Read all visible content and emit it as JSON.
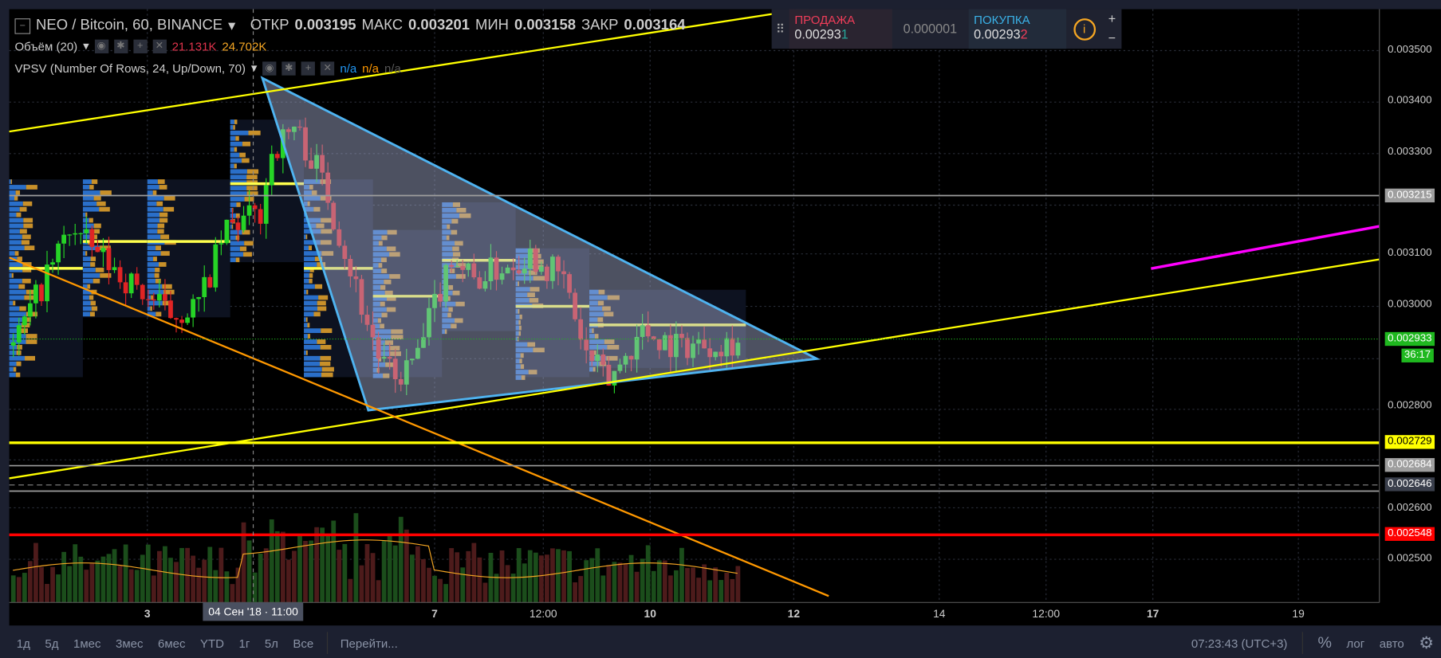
{
  "header": {
    "symbol": "NEO / Bitcoin, 60, BINANCE",
    "open_label": "ОТКР",
    "open": "0.003195",
    "high_label": "МАКС",
    "high": "0.003201",
    "low_label": "МИН",
    "low": "0.003158",
    "close_label": "ЗАКР",
    "close": "0.003164"
  },
  "volume_legend": {
    "name": "Объём (20)",
    "v1": "21.131K",
    "v2": "24.702K"
  },
  "vpsv_legend": {
    "name": "VPSV (Number Of Rows, 24, Up/Down, 70)",
    "v1": "n/a",
    "v2": "n/a",
    "v3": "n/a"
  },
  "trade": {
    "sell_label": "ПРОДАЖА",
    "sell_main": "0.00293",
    "sell_last": "1",
    "spread": "0.000001",
    "buy_label": "ПОКУПКА",
    "buy_main": "0.00293",
    "buy_last": "2",
    "plus": "+",
    "minus": "−"
  },
  "price_axis": [
    {
      "t": "0.003500",
      "p": 0.0035
    },
    {
      "t": "0.003400",
      "p": 0.0034
    },
    {
      "t": "0.003300",
      "p": 0.0033
    },
    {
      "t": "0.003100",
      "p": 0.0031
    },
    {
      "t": "0.003000",
      "p": 0.003
    },
    {
      "t": "0.002800",
      "p": 0.0028
    },
    {
      "t": "0.002600",
      "p": 0.0026
    },
    {
      "t": "0.002500",
      "p": 0.0025
    }
  ],
  "price_tags": [
    {
      "t": "0.003215",
      "p": 0.003215,
      "bg": "#9e9e9e",
      "fg": "#fff"
    },
    {
      "t": "0.002933",
      "p": 0.002933,
      "bg": "#1fb81f",
      "fg": "#fff"
    },
    {
      "t": "36:17",
      "p": 0.0029,
      "bg": "#1fb81f",
      "fg": "#fff"
    },
    {
      "t": "0.002729",
      "p": 0.002729,
      "bg": "#ffff00",
      "fg": "#000"
    },
    {
      "t": "0.002684",
      "p": 0.002684,
      "bg": "#9e9e9e",
      "fg": "#fff"
    },
    {
      "t": "0.002646",
      "p": 0.002646,
      "bg": "#3a3f4c",
      "fg": "#fff"
    },
    {
      "t": "0.002548",
      "p": 0.002548,
      "bg": "#ff0000",
      "fg": "#fff"
    }
  ],
  "time_axis": [
    "3",
    "7",
    "12:00",
    "10",
    "12",
    "14",
    "12:00",
    "17",
    "19"
  ],
  "crosshair_time": "04 Сен '18 · 11:00",
  "toolbar": {
    "ranges": [
      "1д",
      "5д",
      "1мес",
      "3мес",
      "6мес",
      "YTD",
      "1г",
      "5л",
      "Все"
    ],
    "goto": "Перейти...",
    "clock": "07:23:43 (UTC+3)",
    "percent": "%",
    "log": "лог",
    "auto": "авто"
  },
  "chart_data": {
    "type": "candlestick",
    "bars": 130,
    "price_path": [
      [
        0,
        0.00292
      ],
      [
        10,
        0.00315
      ],
      [
        20,
        0.00305
      ],
      [
        28,
        0.00298
      ],
      [
        33,
        0.003
      ],
      [
        38,
        0.00315
      ],
      [
        44,
        0.00318
      ],
      [
        46,
        0.0033
      ],
      [
        50,
        0.00335
      ],
      [
        55,
        0.00325
      ],
      [
        62,
        0.003
      ],
      [
        65,
        0.0029
      ],
      [
        68,
        0.00285
      ],
      [
        72,
        0.0029
      ],
      [
        78,
        0.0031
      ],
      [
        82,
        0.00305
      ],
      [
        92,
        0.0031
      ],
      [
        98,
        0.00305
      ],
      [
        102,
        0.0029
      ],
      [
        106,
        0.00285
      ],
      [
        112,
        0.00295
      ],
      [
        118,
        0.00292
      ],
      [
        130,
        0.00293
      ]
    ],
    "colors": {
      "up": "#26d426",
      "down": "#e02424"
    }
  }
}
